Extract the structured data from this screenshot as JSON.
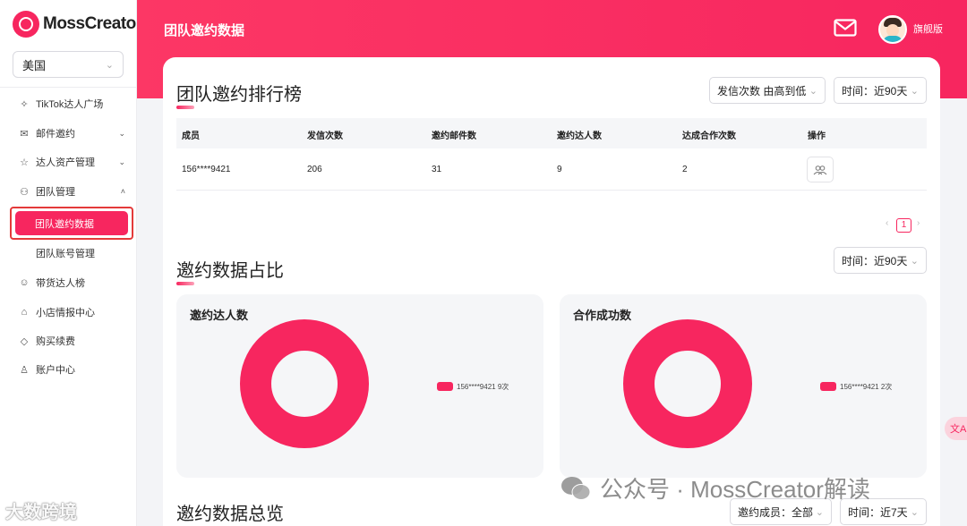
{
  "app": {
    "logo_text": "MossCreator",
    "country": "美国",
    "header_title": "团队邀约数据",
    "plan": "旗舰版"
  },
  "sidebar": {
    "items": [
      {
        "label": "TikTok达人广场",
        "icon": "star-sparkle-icon"
      },
      {
        "label": "邮件邀约",
        "icon": "mail-icon",
        "arrow": "down"
      },
      {
        "label": "达人资产管理",
        "icon": "star-icon",
        "arrow": "down"
      },
      {
        "label": "团队管理",
        "icon": "team-icon",
        "arrow": "up"
      },
      {
        "label": "团队邀约数据",
        "active": true
      },
      {
        "label": "团队账号管理"
      },
      {
        "label": "带货达人榜",
        "icon": "user-icon"
      },
      {
        "label": "小店情报中心",
        "icon": "shop-icon"
      },
      {
        "label": "购买续费",
        "icon": "diamond-icon"
      },
      {
        "label": "账户中心",
        "icon": "account-icon"
      }
    ]
  },
  "ranking": {
    "title": "团队邀约排行榜",
    "sort_select": "发信次数 由高到低",
    "time_select": "时间：近90天",
    "columns": [
      "成员",
      "发信次数",
      "邀约邮件数",
      "邀约达人数",
      "达成合作次数",
      "操作"
    ],
    "rows": [
      {
        "member": "156****9421",
        "sent": "206",
        "emails": "31",
        "creators": "9",
        "deals": "2"
      }
    ],
    "pagination": {
      "prev": "‹",
      "current": "1",
      "next": "›"
    }
  },
  "ratio": {
    "title": "邀约数据占比",
    "time_select": "时间：近90天",
    "panels": [
      {
        "title": "邀约达人数",
        "legend": "156****9421 9次"
      },
      {
        "title": "合作成功数",
        "legend": "156****9421 2次"
      }
    ]
  },
  "overview": {
    "title": "邀约数据总览",
    "member_select": "邀约成员：全部",
    "time_select": "时间：近7天"
  },
  "chart_data": [
    {
      "type": "pie",
      "title": "邀约达人数",
      "categories": [
        "156****9421"
      ],
      "values": [
        9
      ]
    },
    {
      "type": "pie",
      "title": "合作成功数",
      "categories": [
        "156****9421"
      ],
      "values": [
        2
      ]
    }
  ],
  "watermarks": {
    "right": "公众号 · MossCreator解读",
    "left": "大数跨境"
  },
  "translate_button": "文A",
  "colors": {
    "accent": "#f7265f",
    "header": "#fc3765"
  }
}
